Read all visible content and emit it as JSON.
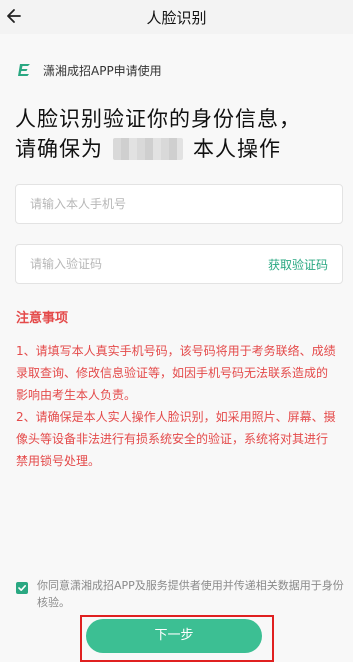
{
  "header": {
    "title": "人脸识别"
  },
  "app": {
    "label": "潇湘成招APP申请使用"
  },
  "headline": {
    "line1": "人脸识别验证你的身份信息，",
    "line2_prefix": "请确保为",
    "line2_suffix": "本人操作"
  },
  "phone_field": {
    "placeholder": "请输入本人手机号",
    "value": ""
  },
  "code_field": {
    "placeholder": "请输入验证码",
    "value": "",
    "get_code_label": "获取验证码"
  },
  "notice": {
    "title": "注意事项",
    "item1": "1、请填写本人真实手机号码，该号码将用于考务联络、成绩录取查询、修改信息验证等，如因手机号码无法联系造成的影响由考生本人负责。",
    "item2": "2、请确保是本人实人操作人脸识别，如采用照片、屏幕、摄像头等设备非法进行有损系统安全的验证，系统将对其进行禁用锁号处理。"
  },
  "agreement": {
    "checked": true,
    "text": "你同意潇湘成招APP及服务提供者使用并传递相关数据用于身份核验。"
  },
  "next_button": {
    "label": "下一步"
  },
  "colors": {
    "accent": "#3cbf93",
    "warning": "#e44a4a",
    "highlight": "#e02020"
  },
  "icons": {
    "back": "back-arrow-icon",
    "logo": "app-logo-icon",
    "check": "check-icon"
  }
}
